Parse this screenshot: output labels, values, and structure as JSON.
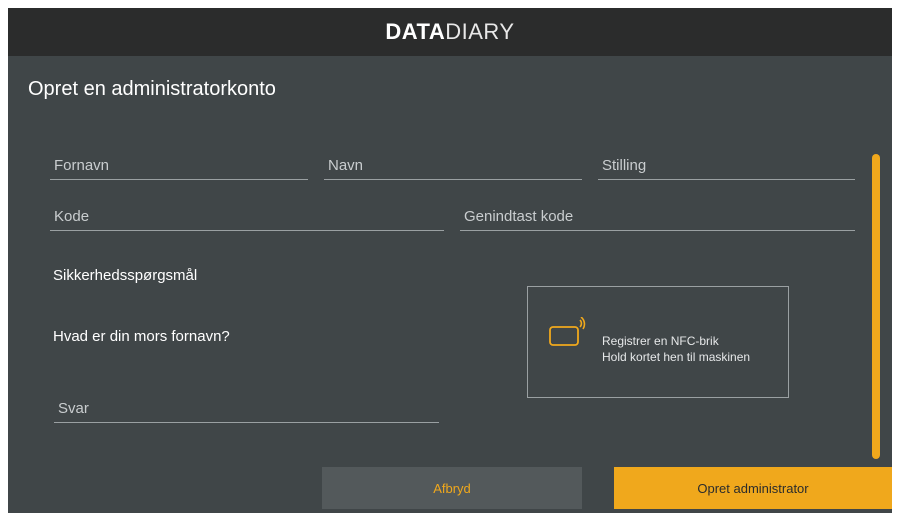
{
  "header": {
    "logo_bold": "DATA",
    "logo_light": "DIARY"
  },
  "page": {
    "title": "Opret en administratorkonto"
  },
  "form": {
    "first_name": {
      "placeholder": "Fornavn",
      "value": ""
    },
    "last_name": {
      "placeholder": "Navn",
      "value": ""
    },
    "position": {
      "placeholder": "Stilling",
      "value": ""
    },
    "password": {
      "placeholder": "Kode",
      "value": ""
    },
    "password_repeat": {
      "placeholder": "Genindtast kode",
      "value": ""
    },
    "security_heading": "Sikkerhedsspørgsmål",
    "security_question": "Hvad er din mors fornavn?",
    "answer": {
      "placeholder": "Svar",
      "value": ""
    }
  },
  "nfc": {
    "icon": "nfc-card-icon",
    "line1": "Registrer en NFC-brik",
    "line2": "Hold kortet hen til maskinen"
  },
  "buttons": {
    "cancel": "Afbryd",
    "create": "Opret administrator"
  },
  "colors": {
    "accent": "#f0a81c",
    "panel": "#404648",
    "header": "#2b2c2c"
  }
}
